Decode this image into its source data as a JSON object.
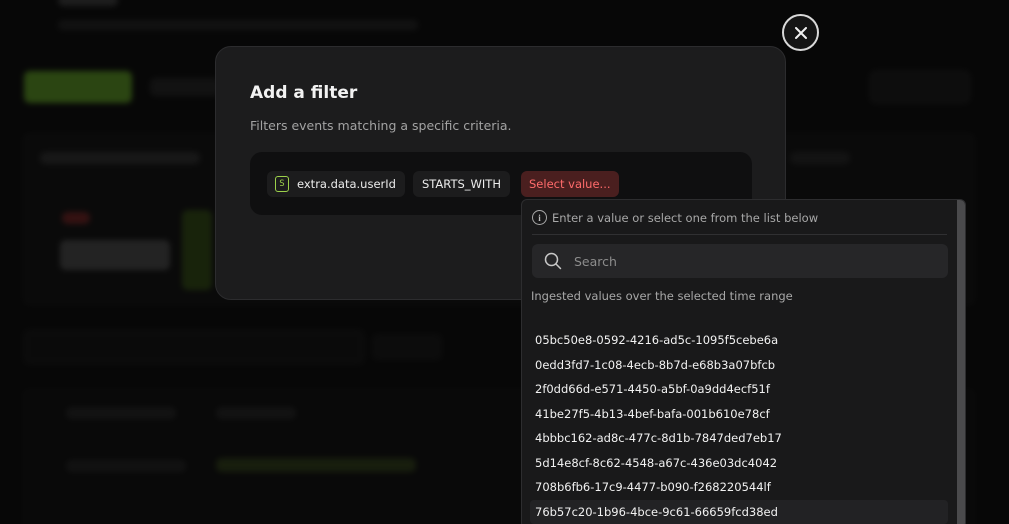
{
  "modal": {
    "title": "Add a filter",
    "description": "Filters events matching a specific criteria.",
    "filter": {
      "field_type_icon": "S",
      "field": "extra.data.userId",
      "operator": "STARTS_WITH",
      "value_placeholder": "Select value..."
    }
  },
  "close_icon": "close-icon",
  "dropdown": {
    "hint": "Enter a value or select one from the list below",
    "search_placeholder": "Search",
    "ingested_label": "Ingested values over the selected time range",
    "values": [
      "05bc50e8-0592-4216-ad5c-1095f5cebe6a",
      "0edd3fd7-1c08-4ecb-8b7d-e68b3a07bfcb",
      "2f0dd66d-e571-4450-a5bf-0a9dd4ecf51f",
      "41be27f5-4b13-4bef-bafa-001b610e78cf",
      "4bbbc162-ad8c-477c-8d1b-7847ded7eb17",
      "5d14e8cf-8c62-4548-a67c-436e03dc4042",
      "708b6fb6-17c9-4477-b090-f268220544lf",
      "76b57c20-1b96-4bce-9c61-66659fcd38ed"
    ]
  },
  "colors": {
    "accent_green": "#9cd14a",
    "value_chip_text": "#ff6b6b",
    "value_chip_bg": "#4a1f1f"
  }
}
